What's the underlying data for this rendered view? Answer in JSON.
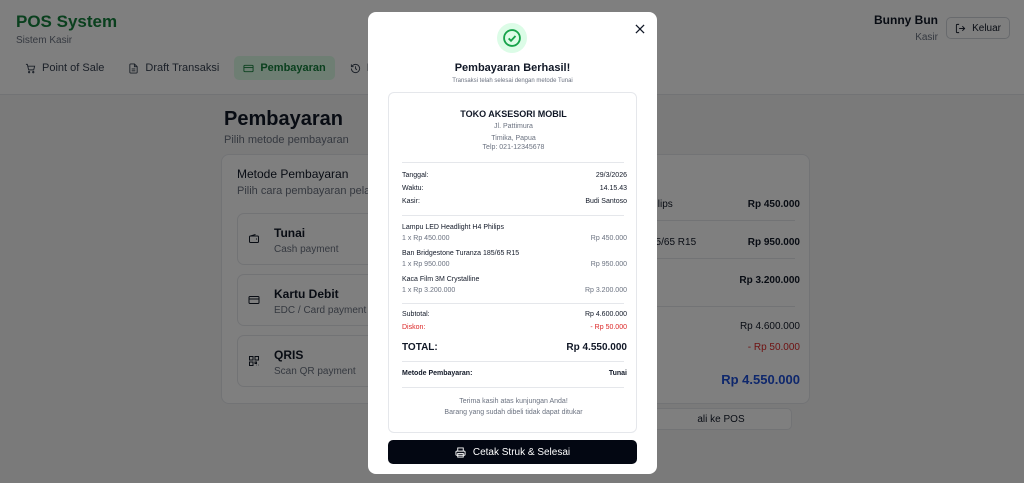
{
  "app": {
    "title": "POS System",
    "subtitle": "Sistem Kasir"
  },
  "user": {
    "name": "Bunny Bun",
    "role": "Kasir",
    "logout_label": "Keluar"
  },
  "nav": {
    "items": [
      {
        "label": "Point of Sale",
        "icon": "cart-icon"
      },
      {
        "label": "Draft Transaksi",
        "icon": "document-icon"
      },
      {
        "label": "Pembayaran",
        "icon": "card-icon",
        "active": true
      },
      {
        "label": "R",
        "icon": "history-icon"
      }
    ]
  },
  "page": {
    "title": "Pembayaran",
    "subtitle": "Pilih metode pembayaran"
  },
  "methods": {
    "title": "Metode Pembayaran",
    "subtitle": "Pilih cara pembayaran pela",
    "options": [
      {
        "label": "Tunai",
        "desc": "Cash payment",
        "icon": "wallet-icon"
      },
      {
        "label": "Kartu Debit",
        "desc": "EDC / Card payment",
        "icon": "credit-card-icon"
      },
      {
        "label": "QRIS",
        "desc": "Scan QR payment",
        "icon": "qr-code-icon"
      }
    ]
  },
  "summary_bg": {
    "rows": [
      {
        "label": "hilips",
        "value": "Rp 450.000"
      },
      {
        "label": "85/65 R15",
        "value": "Rp 950.000"
      },
      {
        "label": "",
        "value": "Rp 3.200.000"
      }
    ],
    "subtotal": "Rp 4.600.000",
    "discount": "- Rp 50.000",
    "total": "Rp 4.550.000",
    "back_label": "ali ke POS"
  },
  "modal": {
    "title": "Pembayaran Berhasil!",
    "subtitle": "Transaksi telah selesai dengan metode Tunai",
    "print_label": "Cetak Struk & Selesai"
  },
  "receipt": {
    "store_name": "TOKO AKSESORI MOBIL",
    "address_1": "Jl. Pattimura",
    "address_2": "Timika, Papua",
    "phone": "Telp: 021-12345678",
    "date_label": "Tanggal:",
    "date_value": "29/3/2026",
    "time_label": "Waktu:",
    "time_value": "14.15.43",
    "cashier_label": "Kasir:",
    "cashier_value": "Budi Santoso",
    "items": [
      {
        "name": "Lampu LED Headlight H4 Philips",
        "qty_price": "1 x Rp 450.000",
        "total": "Rp 450.000"
      },
      {
        "name": "Ban Bridgestone Turanza 185/65 R15",
        "qty_price": "1 x Rp 950.000",
        "total": "Rp 950.000"
      },
      {
        "name": "Kaca Film 3M Crystalline",
        "qty_price": "1 x Rp 3.200.000",
        "total": "Rp 3.200.000"
      }
    ],
    "subtotal_label": "Subtotal:",
    "subtotal_value": "Rp 4.600.000",
    "discount_label": "Diskon:",
    "discount_value": "- Rp 50.000",
    "total_label": "TOTAL:",
    "total_value": "Rp 4.550.000",
    "method_label": "Metode Pembayaran:",
    "method_value": "Tunai",
    "footer_1": "Terima kasih atas kunjungan Anda!",
    "footer_2": "Barang yang sudah dibeli tidak dapat ditukar"
  },
  "colors": {
    "brand": "#15803d",
    "accent_blue": "#1d4ed8",
    "danger": "#dc2626",
    "button_dark": "#030712"
  }
}
